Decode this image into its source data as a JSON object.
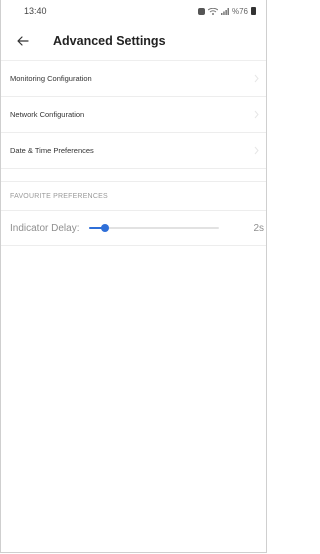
{
  "status_bar": {
    "time": "13:40",
    "battery": "%76"
  },
  "header": {
    "title": "Advanced Settings",
    "back_icon": "arrow-left-icon"
  },
  "menu": {
    "items": [
      {
        "label": "Monitoring Configuration",
        "icon": "chevron-right-icon"
      },
      {
        "label": "Network Configuration",
        "icon": "chevron-right-icon"
      },
      {
        "label": "Date & Time Preferences",
        "icon": "chevron-right-icon"
      }
    ]
  },
  "favourite_section": {
    "header": "FAVOURITE PREFERENCES",
    "indicator_delay": {
      "label": "Indicator Delay:",
      "value_label": "2s",
      "level": 0.12
    }
  },
  "colors": {
    "accent": "#2f6fd8",
    "divider": "#ededed",
    "muted_text": "#8f8f8f"
  }
}
